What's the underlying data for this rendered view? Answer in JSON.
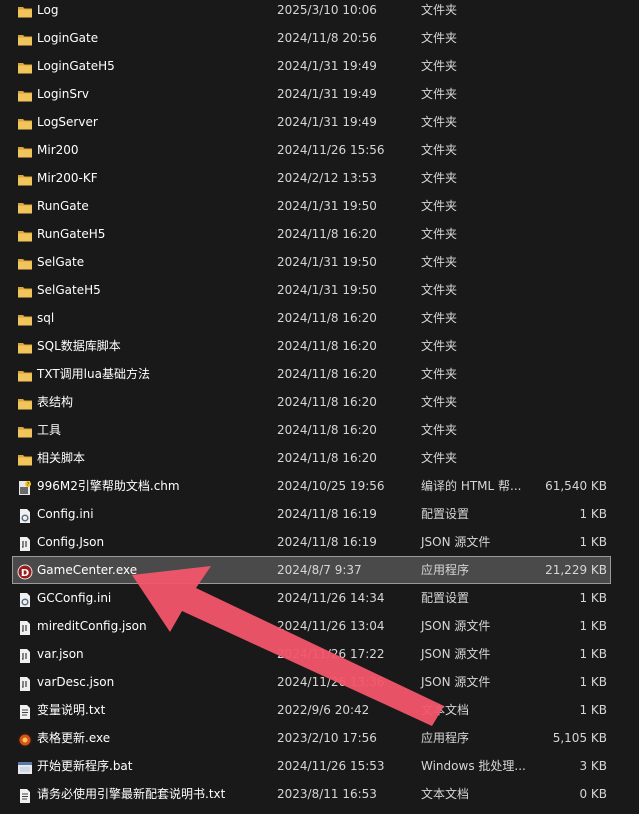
{
  "file_list": {
    "rows": [
      {
        "name": "Log",
        "date": "2025/3/10 10:06",
        "type": "文件夹",
        "size": "",
        "icon": "folder-icon"
      },
      {
        "name": "LoginGate",
        "date": "2024/11/8 20:56",
        "type": "文件夹",
        "size": "",
        "icon": "folder-icon"
      },
      {
        "name": "LoginGateH5",
        "date": "2024/1/31 19:49",
        "type": "文件夹",
        "size": "",
        "icon": "folder-icon"
      },
      {
        "name": "LoginSrv",
        "date": "2024/1/31 19:49",
        "type": "文件夹",
        "size": "",
        "icon": "folder-icon"
      },
      {
        "name": "LogServer",
        "date": "2024/1/31 19:49",
        "type": "文件夹",
        "size": "",
        "icon": "folder-icon"
      },
      {
        "name": "Mir200",
        "date": "2024/11/26 15:56",
        "type": "文件夹",
        "size": "",
        "icon": "folder-icon"
      },
      {
        "name": "Mir200-KF",
        "date": "2024/2/12 13:53",
        "type": "文件夹",
        "size": "",
        "icon": "folder-icon"
      },
      {
        "name": "RunGate",
        "date": "2024/1/31 19:50",
        "type": "文件夹",
        "size": "",
        "icon": "folder-icon"
      },
      {
        "name": "RunGateH5",
        "date": "2024/11/8 16:20",
        "type": "文件夹",
        "size": "",
        "icon": "folder-icon"
      },
      {
        "name": "SelGate",
        "date": "2024/1/31 19:50",
        "type": "文件夹",
        "size": "",
        "icon": "folder-icon"
      },
      {
        "name": "SelGateH5",
        "date": "2024/1/31 19:50",
        "type": "文件夹",
        "size": "",
        "icon": "folder-icon"
      },
      {
        "name": "sql",
        "date": "2024/11/8 16:20",
        "type": "文件夹",
        "size": "",
        "icon": "folder-icon"
      },
      {
        "name": "SQL数据库脚本",
        "date": "2024/11/8 16:20",
        "type": "文件夹",
        "size": "",
        "icon": "folder-icon"
      },
      {
        "name": "TXT调用lua基础方法",
        "date": "2024/11/8 16:20",
        "type": "文件夹",
        "size": "",
        "icon": "folder-icon"
      },
      {
        "name": "表结构",
        "date": "2024/11/8 16:20",
        "type": "文件夹",
        "size": "",
        "icon": "folder-icon"
      },
      {
        "name": "工具",
        "date": "2024/11/8 16:20",
        "type": "文件夹",
        "size": "",
        "icon": "folder-icon"
      },
      {
        "name": "相关脚本",
        "date": "2024/11/8 16:20",
        "type": "文件夹",
        "size": "",
        "icon": "folder-icon"
      },
      {
        "name": "996M2引擎帮助文档.chm",
        "date": "2024/10/25 19:56",
        "type": "编译的 HTML 帮...",
        "size": "61,540 KB",
        "icon": "help-file-icon"
      },
      {
        "name": "Config.ini",
        "date": "2024/11/8 16:19",
        "type": "配置设置",
        "size": "1 KB",
        "icon": "config-file-icon"
      },
      {
        "name": "Config.Json",
        "date": "2024/11/8 16:19",
        "type": "JSON 源文件",
        "size": "1 KB",
        "icon": "json-file-icon"
      },
      {
        "name": "GameCenter.exe",
        "date": "2024/8/7 9:37",
        "type": "应用程序",
        "size": "21,229 KB",
        "icon": "gamecenter-app-icon",
        "selected": true
      },
      {
        "name": "GCConfig.ini",
        "date": "2024/11/26 14:34",
        "type": "配置设置",
        "size": "1 KB",
        "icon": "config-file-icon"
      },
      {
        "name": "mireditConfig.json",
        "date": "2024/11/26 13:04",
        "type": "JSON 源文件",
        "size": "1 KB",
        "icon": "json-file-icon"
      },
      {
        "name": "var.json",
        "date": "2024/11/26 17:22",
        "type": "JSON 源文件",
        "size": "1 KB",
        "icon": "json-file-icon"
      },
      {
        "name": "varDesc.json",
        "date": "2024/11/26 13:36",
        "type": "JSON 源文件",
        "size": "1 KB",
        "icon": "json-file-icon"
      },
      {
        "name": "变量说明.txt",
        "date": "2022/9/6 20:42",
        "type": "文本文档",
        "size": "1 KB",
        "icon": "text-file-icon"
      },
      {
        "name": "表格更新.exe",
        "date": "2023/2/10 17:56",
        "type": "应用程序",
        "size": "5,105 KB",
        "icon": "table-update-app-icon"
      },
      {
        "name": "开始更新程序.bat",
        "date": "2024/11/26 15:53",
        "type": "Windows 批处理...",
        "size": "3 KB",
        "icon": "batch-file-icon"
      },
      {
        "name": "请务必使用引擎最新配套说明书.txt",
        "date": "2023/8/11 16:53",
        "type": "文本文档",
        "size": "0 KB",
        "icon": "text-file-icon"
      }
    ]
  },
  "colors": {
    "background": "#191919",
    "folder": "#f2c55c",
    "annotation_arrow": "#f2556a",
    "selected_row": "#4a4a4a"
  }
}
